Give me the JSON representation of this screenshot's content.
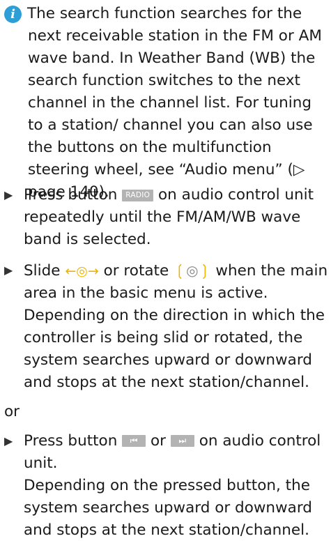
{
  "info": {
    "icon": "info-icon",
    "text": "The search function searches for the next receivable station in the FM or AM wave band. In Weather Band (WB) the search function switches to the next channel in the channel list. For tuning to a station/ channel you can also use the buttons on the multifunction steering wheel, see “Audio menu” (▷ page 140)."
  },
  "steps": [
    {
      "before": "Press button",
      "key": "RADIO",
      "after": "on audio control unit repeatedly until the FM/AM/WB wave band is selected."
    },
    {
      "before": "Slide",
      "slide_symbol": "←◎→",
      "middle": "or rotate",
      "rotate_symbol": "◎",
      "after": "when the main area in the basic menu is active.",
      "desc": "Depending on the direction in which the controller is being slid or rotated, the system searches upward or downward and stops at the next station/channel."
    }
  ],
  "or_text": "or",
  "step3": {
    "before": "Press button",
    "key_prev": "⏮",
    "middle": "or",
    "key_next": "⏭",
    "after": "on audio control unit.",
    "desc": "Depending on the pressed button, the system searches upward or downward and stops at the next station/channel."
  }
}
